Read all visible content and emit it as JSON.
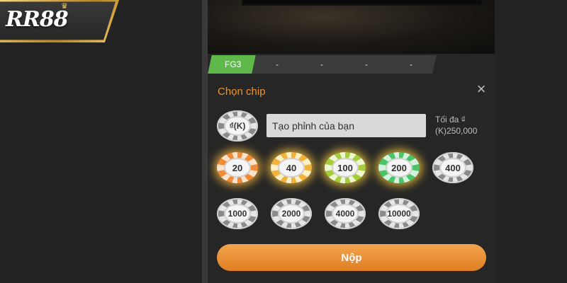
{
  "brand": {
    "logo_text": "RR88"
  },
  "tabs": [
    {
      "label": "FG3",
      "active": true
    },
    {
      "label": "-",
      "active": false
    },
    {
      "label": "-",
      "active": false
    },
    {
      "label": "-",
      "active": false
    },
    {
      "label": "-",
      "active": false
    }
  ],
  "chip_panel": {
    "title": "Chọn chip",
    "close_icon": "×",
    "currency_chip_label": "₫(K)",
    "custom_chip_placeholder": "Tạo phỉnh của bạn",
    "max_label": "Tối đa ₫ (K)250,000",
    "chips_row1": [
      "20",
      "40",
      "100",
      "200",
      "400"
    ],
    "chips_row2": [
      "1000",
      "2000",
      "4000",
      "10000"
    ],
    "submit_label": "Nộp"
  },
  "colors": {
    "accent": "#f0912a",
    "active_tab": "#5fb84a",
    "submit": "#e88d33"
  }
}
